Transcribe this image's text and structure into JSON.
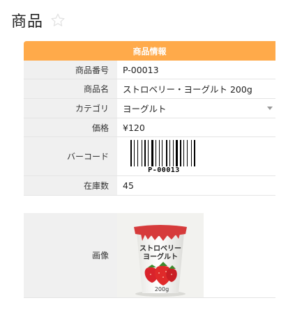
{
  "page": {
    "title": "商品"
  },
  "detail": {
    "section_title": "商品情報",
    "rows": [
      {
        "label": "商品番号",
        "value": "P-00013"
      },
      {
        "label": "商品名",
        "value": "ストロベリー・ヨーグルト 200g"
      },
      {
        "label": "カテゴリ",
        "value": "ヨーグルト"
      },
      {
        "label": "価格",
        "value": "¥120"
      },
      {
        "label": "バーコード",
        "value": "P-00013"
      },
      {
        "label": "在庫数",
        "value": "45"
      }
    ],
    "image": {
      "label": "画像",
      "product_text_line1": "ストロベリー",
      "product_text_line2": "ヨーグルト",
      "product_size": "200g"
    }
  },
  "colors": {
    "section_header": "#ffaa4a",
    "label_bg": "#f0f0f0",
    "cup_lid": "#d63b3b"
  },
  "icons": {
    "favorite": "star-outline-icon",
    "dropdown": "caret-down-icon"
  }
}
